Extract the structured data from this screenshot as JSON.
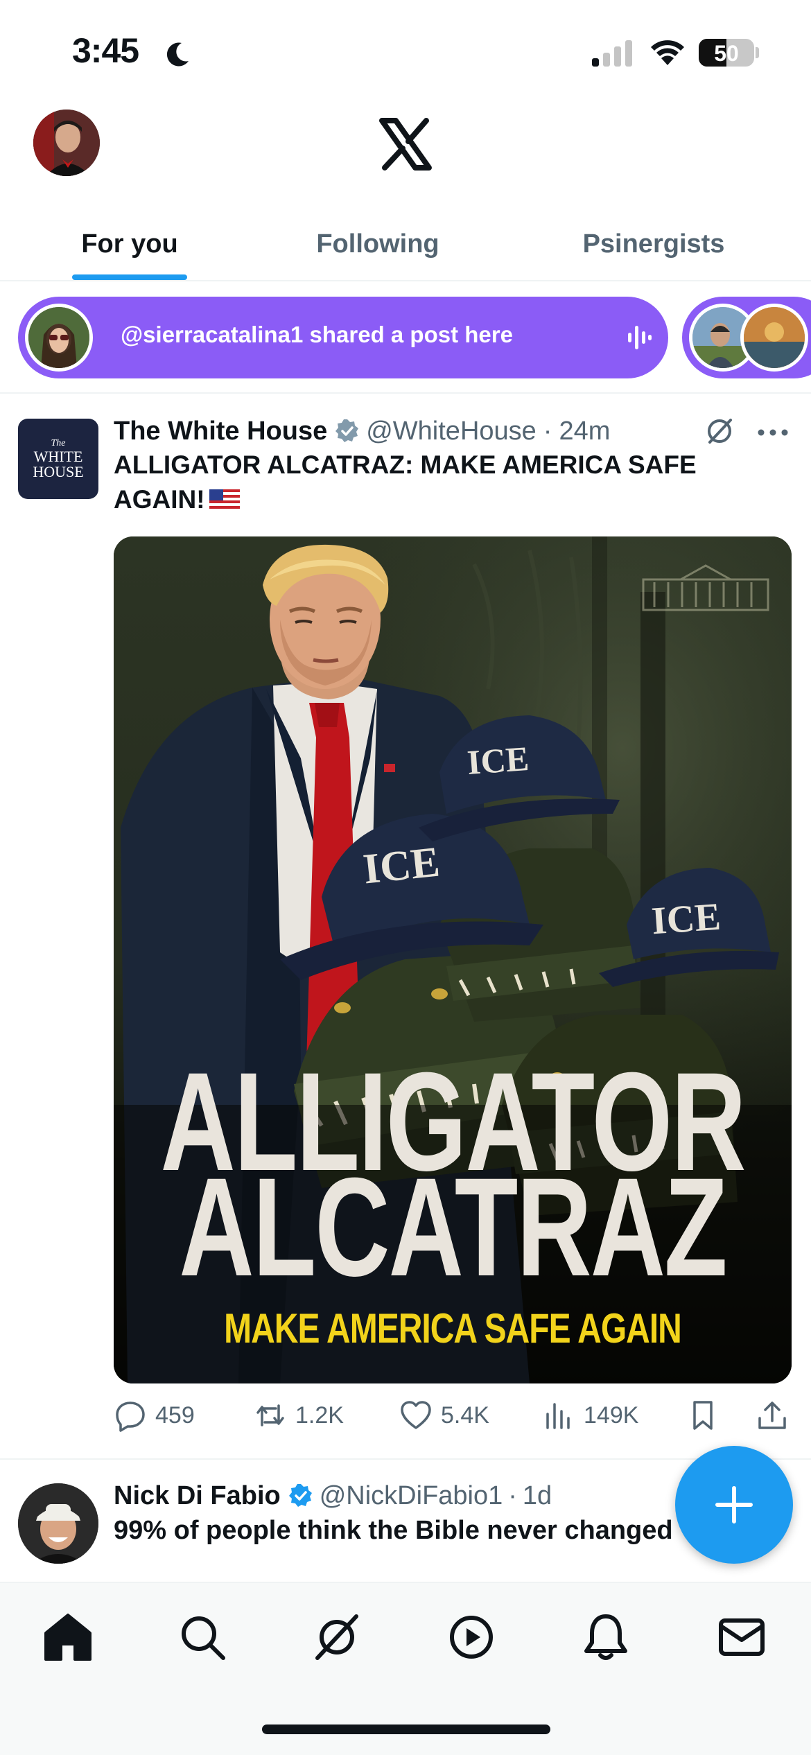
{
  "status_bar": {
    "time": "3:45",
    "battery_level": "50",
    "battery_fraction": 0.5,
    "icons": [
      "moon-icon",
      "cellular-signal-icon",
      "wifi-icon",
      "battery-icon"
    ]
  },
  "header": {
    "logo": "X",
    "icons": [
      "profile-avatar",
      "x-logo-icon"
    ]
  },
  "tabs": [
    {
      "label": "For you",
      "active": true
    },
    {
      "label": "Following",
      "active": false
    },
    {
      "label": "Psinergists",
      "active": false
    }
  ],
  "banner": {
    "text": "@sierracatalina1 shared a post here",
    "icon": "audio-wave-icon"
  },
  "post": {
    "author": "The White House",
    "handle": "@WhiteHouse",
    "separator": "·",
    "time": "24m",
    "text": "ALLIGATOR ALCATRAZ: MAKE AMERICA SAFE AGAIN!",
    "avatar_text_the": "The",
    "avatar_text_name_1": "WHITE",
    "avatar_text_name_2": "HOUSE",
    "media": {
      "title_line_1": "ALLIGATOR",
      "title_line_2": "ALCATRAZ",
      "subtitle": "MAKE AMERICA SAFE AGAIN",
      "cap_label": "ICE"
    },
    "actions": {
      "replies": "459",
      "reposts": "1.2K",
      "likes": "5.4K",
      "views": "149K"
    }
  },
  "post2": {
    "author": "Nick Di Fabio",
    "handle": "@NickDiFabio1",
    "separator": "·",
    "time": "1d",
    "text": "99% of people think the Bible never changed"
  },
  "colors": {
    "accent": "#1d9bf0",
    "banner": "#8b5cf6",
    "text_primary": "#0f1419",
    "text_secondary": "#536471",
    "poster_yellow": "#f2d31b"
  },
  "bottom_nav": [
    "home-icon",
    "search-icon",
    "grok-icon",
    "video-icon",
    "notifications-icon",
    "messages-icon"
  ]
}
